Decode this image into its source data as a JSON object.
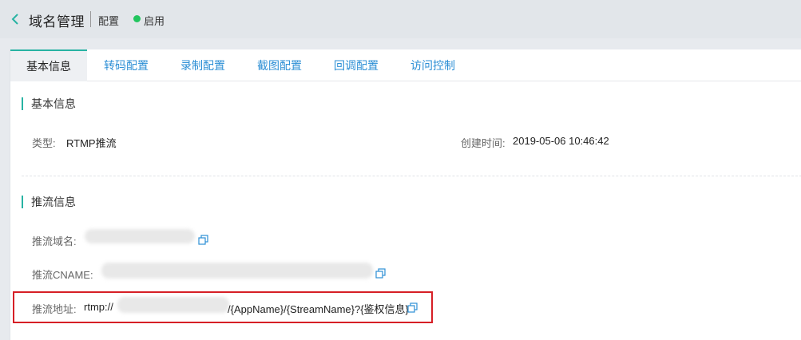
{
  "header": {
    "title": "域名管理",
    "subtitle": "配置",
    "status_label": "启用",
    "status_color": "#22c55e"
  },
  "tabs": [
    {
      "label": "基本信息",
      "active": true
    },
    {
      "label": "转码配置",
      "active": false
    },
    {
      "label": "录制配置",
      "active": false
    },
    {
      "label": "截图配置",
      "active": false
    },
    {
      "label": "回调配置",
      "active": false
    },
    {
      "label": "访问控制",
      "active": false
    }
  ],
  "basic_info": {
    "section_title": "基本信息",
    "type_label": "类型:",
    "type_value": "RTMP推流",
    "created_label": "创建时间:",
    "created_value": "2019-05-06 10:46:42"
  },
  "push_info": {
    "section_title": "推流信息",
    "domain_label": "推流域名:",
    "cname_label": "推流CNAME:",
    "address_label": "推流地址:",
    "address_prefix": "rtmp://",
    "address_suffix": "/{AppName}/{StreamName}?{鉴权信息}"
  },
  "colors": {
    "accent": "#28b3a3",
    "link": "#2d8fd5",
    "highlight": "#d61f26"
  }
}
